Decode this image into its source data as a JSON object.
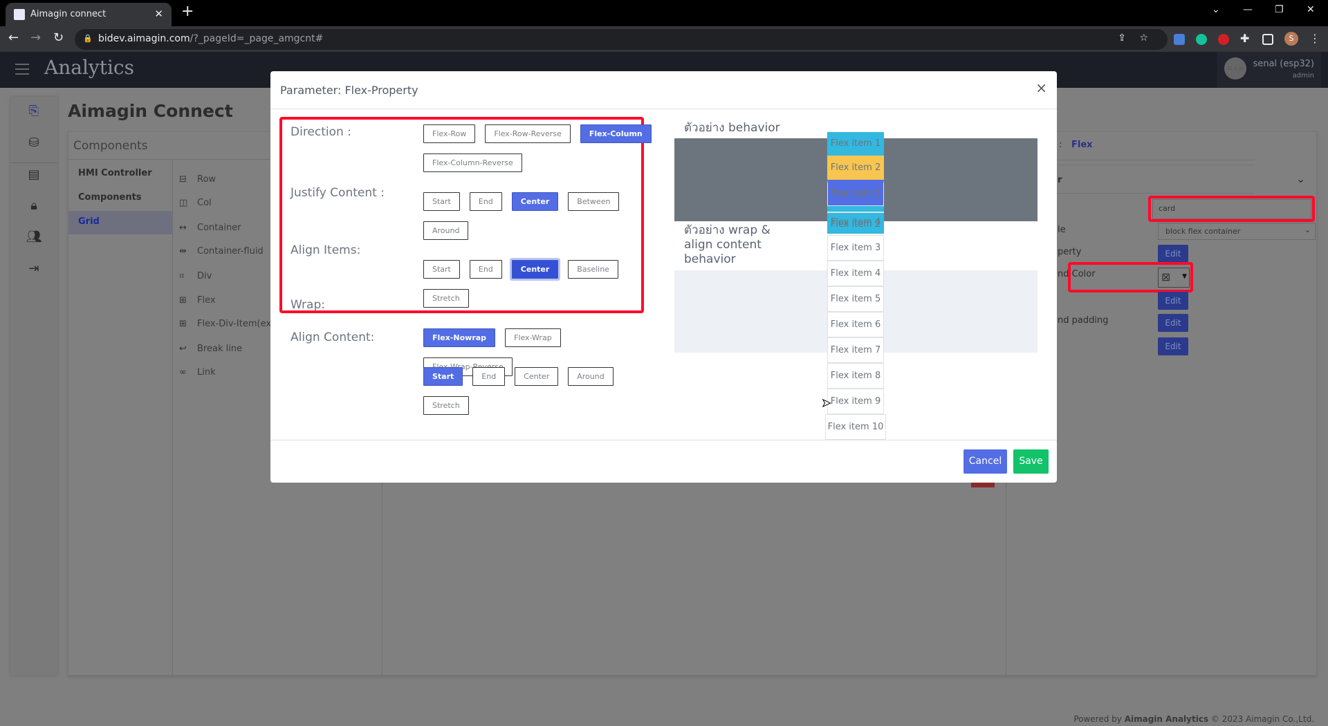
{
  "browser": {
    "tab_title": "Aimagin connect",
    "url_domain": "bidev.aimagin.com",
    "url_path": "/?_pageId=_page_amgcnt#",
    "profile_initial": "S"
  },
  "app": {
    "logo": "Analytics",
    "user_name": "senal (esp32)",
    "user_role": "admin",
    "avatar_placeholder": "32 x 32",
    "page_title": "Aimagin Connect",
    "footer_prefix": "Powered by ",
    "footer_brand": "Aimagin Analytics",
    "footer_suffix": " © 2023 Aimagin Co.,Ltd."
  },
  "components_panel": {
    "title": "Components",
    "categories": [
      {
        "label": "HMI Controller",
        "selected": false
      },
      {
        "label": "Components",
        "selected": false
      },
      {
        "label": "Grid",
        "selected": true
      }
    ],
    "items": [
      {
        "icon": "⊟",
        "label": "Row"
      },
      {
        "icon": "◫",
        "label": "Col"
      },
      {
        "icon": "↔",
        "label": "Container"
      },
      {
        "icon": "⇹",
        "label": "Container-fluid"
      },
      {
        "icon": "⌗",
        "label": "Div"
      },
      {
        "icon": "⊞",
        "label": "Flex"
      },
      {
        "icon": "⊞",
        "label": "Flex-Div-Item(exp"
      },
      {
        "icon": "↩",
        "label": "Break line"
      },
      {
        "icon": "∞",
        "label": "Link"
      }
    ]
  },
  "properties_panel": {
    "type_separator": ":",
    "type_value": "Flex",
    "section_fragment": "r",
    "class_value": "card",
    "style_label_fragment": "le",
    "style_value": "block flex container",
    "property_label_fragment": "perty",
    "color_label_fragment": "nd Color",
    "padding_label_fragment": "nd padding",
    "edit_label": "Edit"
  },
  "modal": {
    "title": "Parameter: Flex-Property",
    "close": "×",
    "groups": [
      {
        "label": "Direction :",
        "options": [
          "Flex-Row",
          "Flex-Row-Reverse",
          "Flex-Column",
          "Flex-Column-Reverse"
        ],
        "selected": "Flex-Column"
      },
      {
        "label": "Justify Content :",
        "options": [
          "Start",
          "End",
          "Center",
          "Between",
          "Around"
        ],
        "selected": "Center"
      },
      {
        "label": "Align Items:",
        "options": [
          "Start",
          "End",
          "Center",
          "Baseline",
          "Stretch"
        ],
        "selected": "Center"
      },
      {
        "label": "Wrap:",
        "options": [
          "Flex-Nowrap",
          "Flex-Wrap",
          "Flex-Wrap-Reverse"
        ],
        "selected": "Flex-Nowrap"
      },
      {
        "label": "Align Content:",
        "options": [
          "Start",
          "End",
          "Center",
          "Around",
          "Stretch"
        ],
        "selected": "Start"
      }
    ],
    "preview_title_1": "ตัวอย่าง behavior",
    "preview_title_2": "ตัวอย่าง wrap & align content behavior",
    "preview1_items": [
      "Flex item 1",
      "Flex item 2",
      "Flex item 3",
      "Flex item 4"
    ],
    "preview2_items": [
      "Flex item 1",
      "Flex item 2",
      "Flex item 3",
      "Flex item 4",
      "Flex item 5",
      "Flex item 6",
      "Flex item 7",
      "Flex item 8",
      "Flex item 9",
      "Flex item 10"
    ],
    "cancel_label": "Cancel",
    "save_label": "Save",
    "colors": {
      "primary": "#536de5",
      "success": "#12c36a",
      "cyan": "#33b8e0",
      "yellow": "#f8c650",
      "gray": "#6c757d",
      "highlight": "#ff0a2a"
    }
  }
}
